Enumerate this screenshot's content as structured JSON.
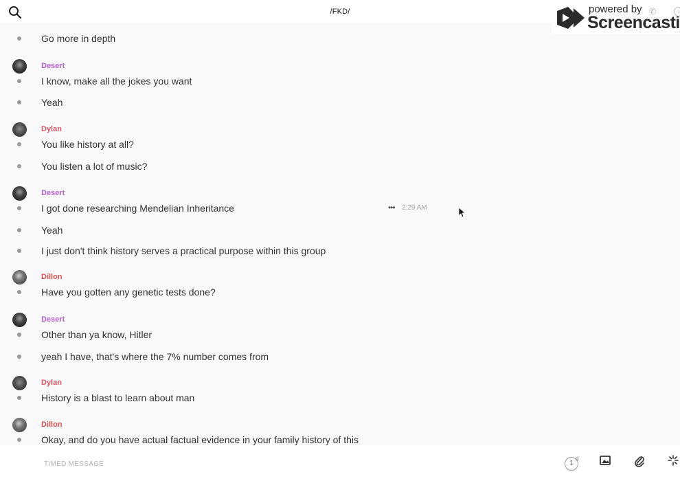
{
  "header": {
    "channel_title": "/FKD/",
    "search_icon": "search-icon"
  },
  "screencastify": {
    "powered_by": "powered by",
    "brand": "Screencastify",
    "icons": [
      "video-camera-icon",
      "phone-icon",
      "info-icon"
    ]
  },
  "users": {
    "desert": {
      "name": "Desert",
      "color": "#bb5fd6"
    },
    "dylan": {
      "name": "Dylan",
      "color": "#e05563"
    },
    "dillon": {
      "name": "Dillon",
      "color": "#d9534f"
    }
  },
  "messages": [
    {
      "text": "Go more in depth"
    },
    {
      "author": "Desert",
      "text": "I know, make all the jokes you want"
    },
    {
      "text": "Yeah"
    },
    {
      "author": "Dylan",
      "text": "You like history at all?"
    },
    {
      "text": "You listen a lot of music?"
    },
    {
      "author": "Desert",
      "text": "I got done researching Mendelian Inheritance",
      "time": "2:29 AM",
      "menu": "•••"
    },
    {
      "text": "Yeah"
    },
    {
      "text": "I just don't think history serves a practical purpose within this group"
    },
    {
      "author": "Dillon",
      "text": "Have you gotten any genetic tests done?"
    },
    {
      "author": "Desert",
      "text": "Other than ya know, Hitler"
    },
    {
      "text": "yeah I have, that's where the 7% number comes from"
    },
    {
      "author": "Dylan",
      "text": "History is a blast to learn about man"
    },
    {
      "author": "Dillon",
      "text": "Okay, and do you have actual factual evidence in your family history of this"
    }
  ],
  "composer": {
    "placeholder": "TIMED MESSAGE",
    "timer_value": "1",
    "timer_unit": "d",
    "tools": [
      "timer-icon",
      "image-icon",
      "paperclip-icon",
      "sparkle-icon"
    ]
  }
}
